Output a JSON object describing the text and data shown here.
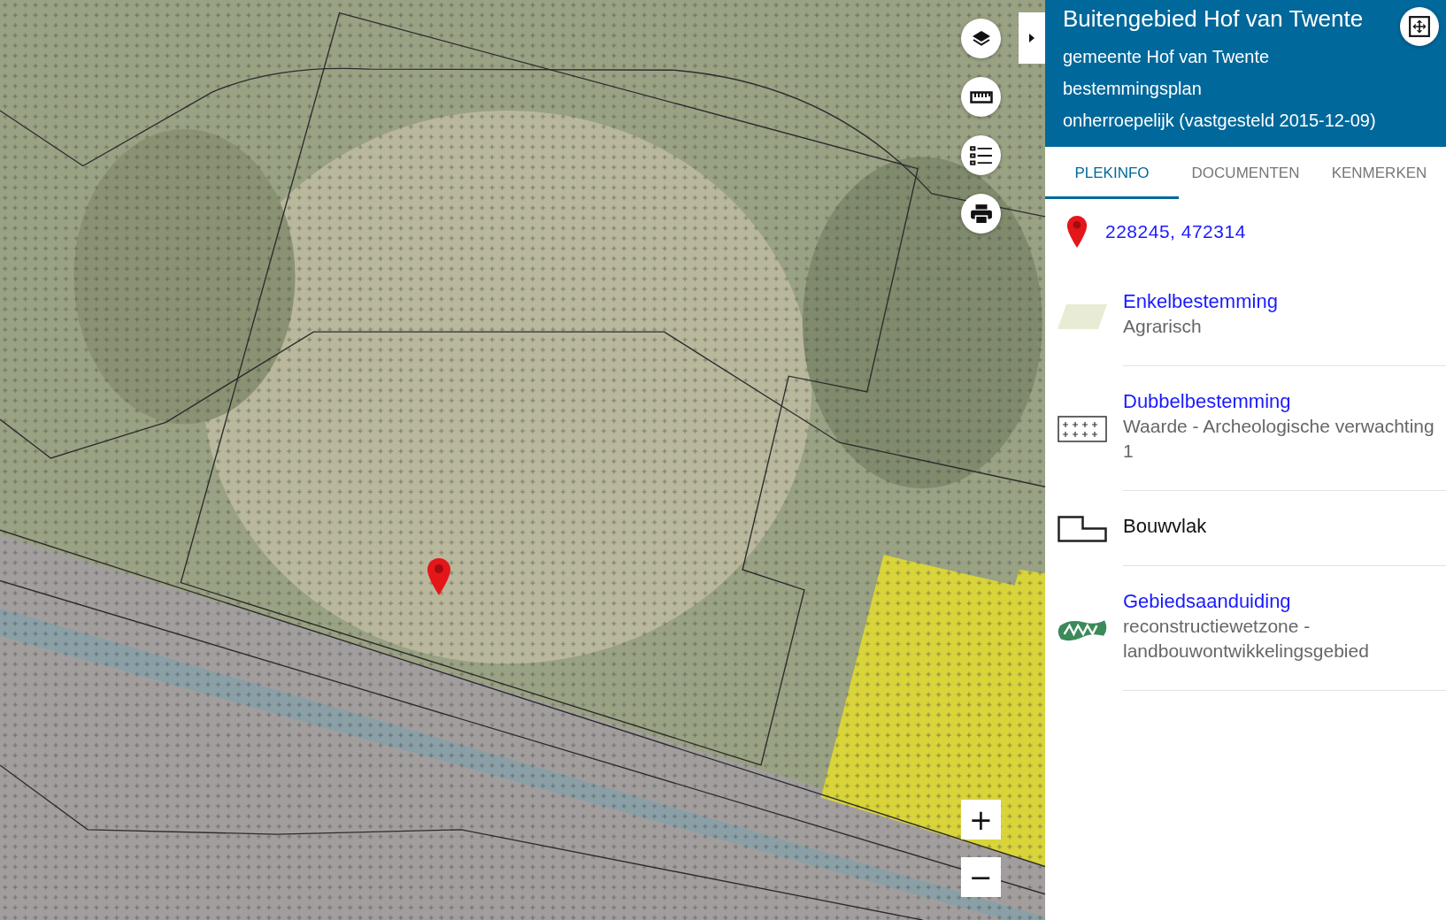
{
  "map": {
    "controls": [
      {
        "kind": "layers"
      },
      {
        "kind": "ruler"
      },
      {
        "kind": "list"
      },
      {
        "kind": "print"
      }
    ],
    "zoom": [
      "+",
      "−"
    ]
  },
  "panel": {
    "header": {
      "title": "Buitengebied Hof van Twente",
      "lines": [
        "gemeente Hof van Twente",
        "bestemmingsplan",
        "onherroepelijk (vastgesteld 2015-12-09)"
      ]
    },
    "tabs": [
      {
        "label": "PLEKINFO",
        "selected": true
      },
      {
        "label": "DOCUMENTEN",
        "selected": false
      },
      {
        "label": "KENMERKEN",
        "selected": false
      }
    ],
    "location": "228245, 472314",
    "items": [
      {
        "kind": "plane",
        "title": "Enkelbestemming",
        "linked": true,
        "description": "Agrarisch"
      },
      {
        "kind": "dotted",
        "title": "Dubbelbestemming",
        "linked": true,
        "description": "Waarde - Archeologische verwachting 1"
      },
      {
        "kind": "outline",
        "title": "Bouwvlak",
        "linked": false
      },
      {
        "kind": "zone",
        "title": "Gebiedsaanduiding",
        "linked": true,
        "description": "reconstructiewetzone - landbouwontwikkelingsgebied"
      }
    ]
  }
}
